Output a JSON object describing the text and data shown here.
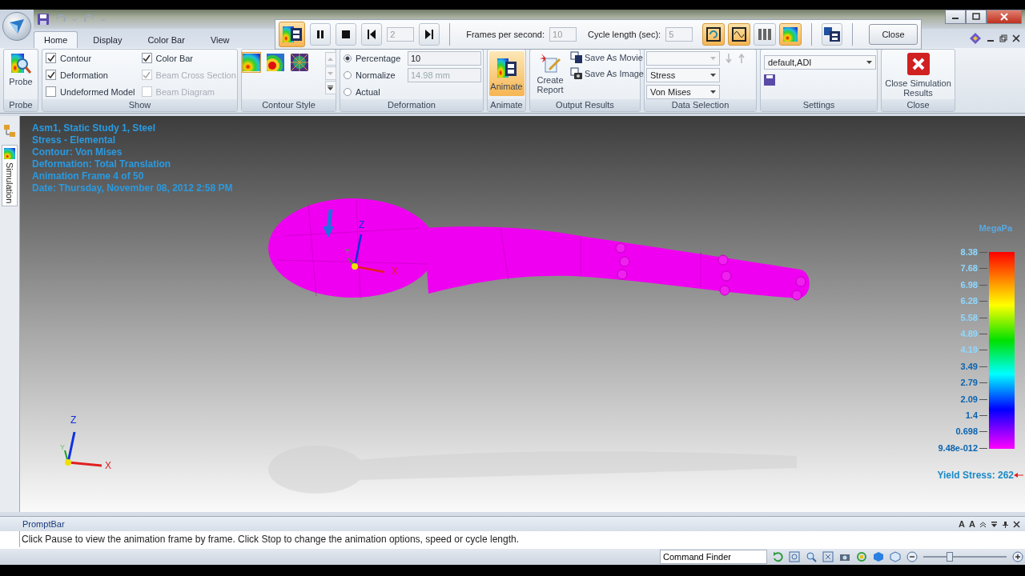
{
  "tabs": [
    {
      "label": "Home",
      "selected": true
    },
    {
      "label": "Display",
      "selected": false
    },
    {
      "label": "Color Bar",
      "selected": false
    },
    {
      "label": "View",
      "selected": false
    }
  ],
  "animation_bar": {
    "film_selected": true,
    "frame": "2",
    "fps_label": "Frames per second:",
    "fps": "10",
    "cycle_label": "Cycle length (sec):",
    "cycle": "5",
    "close": "Close",
    "options": [
      {
        "kind": "loop",
        "selected": true
      },
      {
        "kind": "wave",
        "selected": true
      },
      {
        "kind": "bars",
        "selected": false
      },
      {
        "kind": "contour",
        "selected": true
      }
    ]
  },
  "ribbon": {
    "probe": {
      "button": "Probe",
      "label": "Probe"
    },
    "show": {
      "label": "Show",
      "items": [
        {
          "label": "Contour",
          "checked": true,
          "disabled": false
        },
        {
          "label": "Deformation",
          "checked": true,
          "disabled": false
        },
        {
          "label": "Undeformed Model",
          "checked": false,
          "disabled": false
        },
        {
          "label": "Color Bar",
          "checked": true,
          "disabled": false
        },
        {
          "label": "Beam Cross Section",
          "checked": true,
          "disabled": true
        },
        {
          "label": "Beam Diagram",
          "checked": false,
          "disabled": true
        }
      ]
    },
    "contour_style": {
      "label": "Contour Style",
      "styles": [
        {
          "kind": "smooth",
          "selected": true
        },
        {
          "kind": "banded",
          "selected": false
        },
        {
          "kind": "mesh",
          "selected": false
        }
      ]
    },
    "deformation": {
      "label": "Deformation",
      "options": [
        {
          "label": "Percentage",
          "selected": true,
          "value": "10",
          "disabled": false
        },
        {
          "label": "Normalize",
          "selected": false,
          "value": "14.98 mm",
          "disabled": true
        },
        {
          "label": "Actual",
          "selected": false
        }
      ]
    },
    "animate": {
      "button": "Animate",
      "selected": true,
      "label": "Animate"
    },
    "output": {
      "label": "Output Results",
      "create_report": "Create Report",
      "save_movie": "Save As Movie",
      "save_image": "Save As Image"
    },
    "data_selection": {
      "label": "Data Selection",
      "dropdowns": [
        {
          "value": "Stress"
        },
        {
          "value": "Von Mises"
        }
      ]
    },
    "settings": {
      "label": "Settings",
      "value": "default,ADI"
    },
    "close": {
      "label": "Close",
      "button": "Close Simulation Results"
    }
  },
  "side_tab": {
    "label": "Simulation"
  },
  "viewport": {
    "info": [
      "Asm1, Static Study 1, Steel",
      "Stress - Elemental",
      "Contour: Von Mises",
      "Deformation: Total Translation",
      "Animation Frame 4 of 50",
      "Date: Thursday, November 08, 2012  2:58 PM"
    ],
    "legend": {
      "unit": "MegaPa",
      "ticks": [
        "8.38",
        "7.68",
        "6.98",
        "6.28",
        "5.58",
        "4.89",
        "4.19",
        "3.49",
        "2.79",
        "2.09",
        "1.4",
        "0.698",
        "9.48e-012"
      ],
      "yield": "Yield Stress: 262"
    },
    "model_triad": {
      "z": "Z",
      "y": "Y",
      "x": "X"
    },
    "corner_triad": {
      "z": "Z",
      "y": "Y",
      "x": "X"
    }
  },
  "prompt_bar": {
    "title": "PromptBar",
    "message": "Click Pause to view the animation frame by frame. Click Stop to change the animation options, speed or cycle length.",
    "controls": [
      "A",
      "A"
    ]
  },
  "status_bar": {
    "command_finder": "Command Finder",
    "zoom": {
      "level": 0.3
    }
  }
}
